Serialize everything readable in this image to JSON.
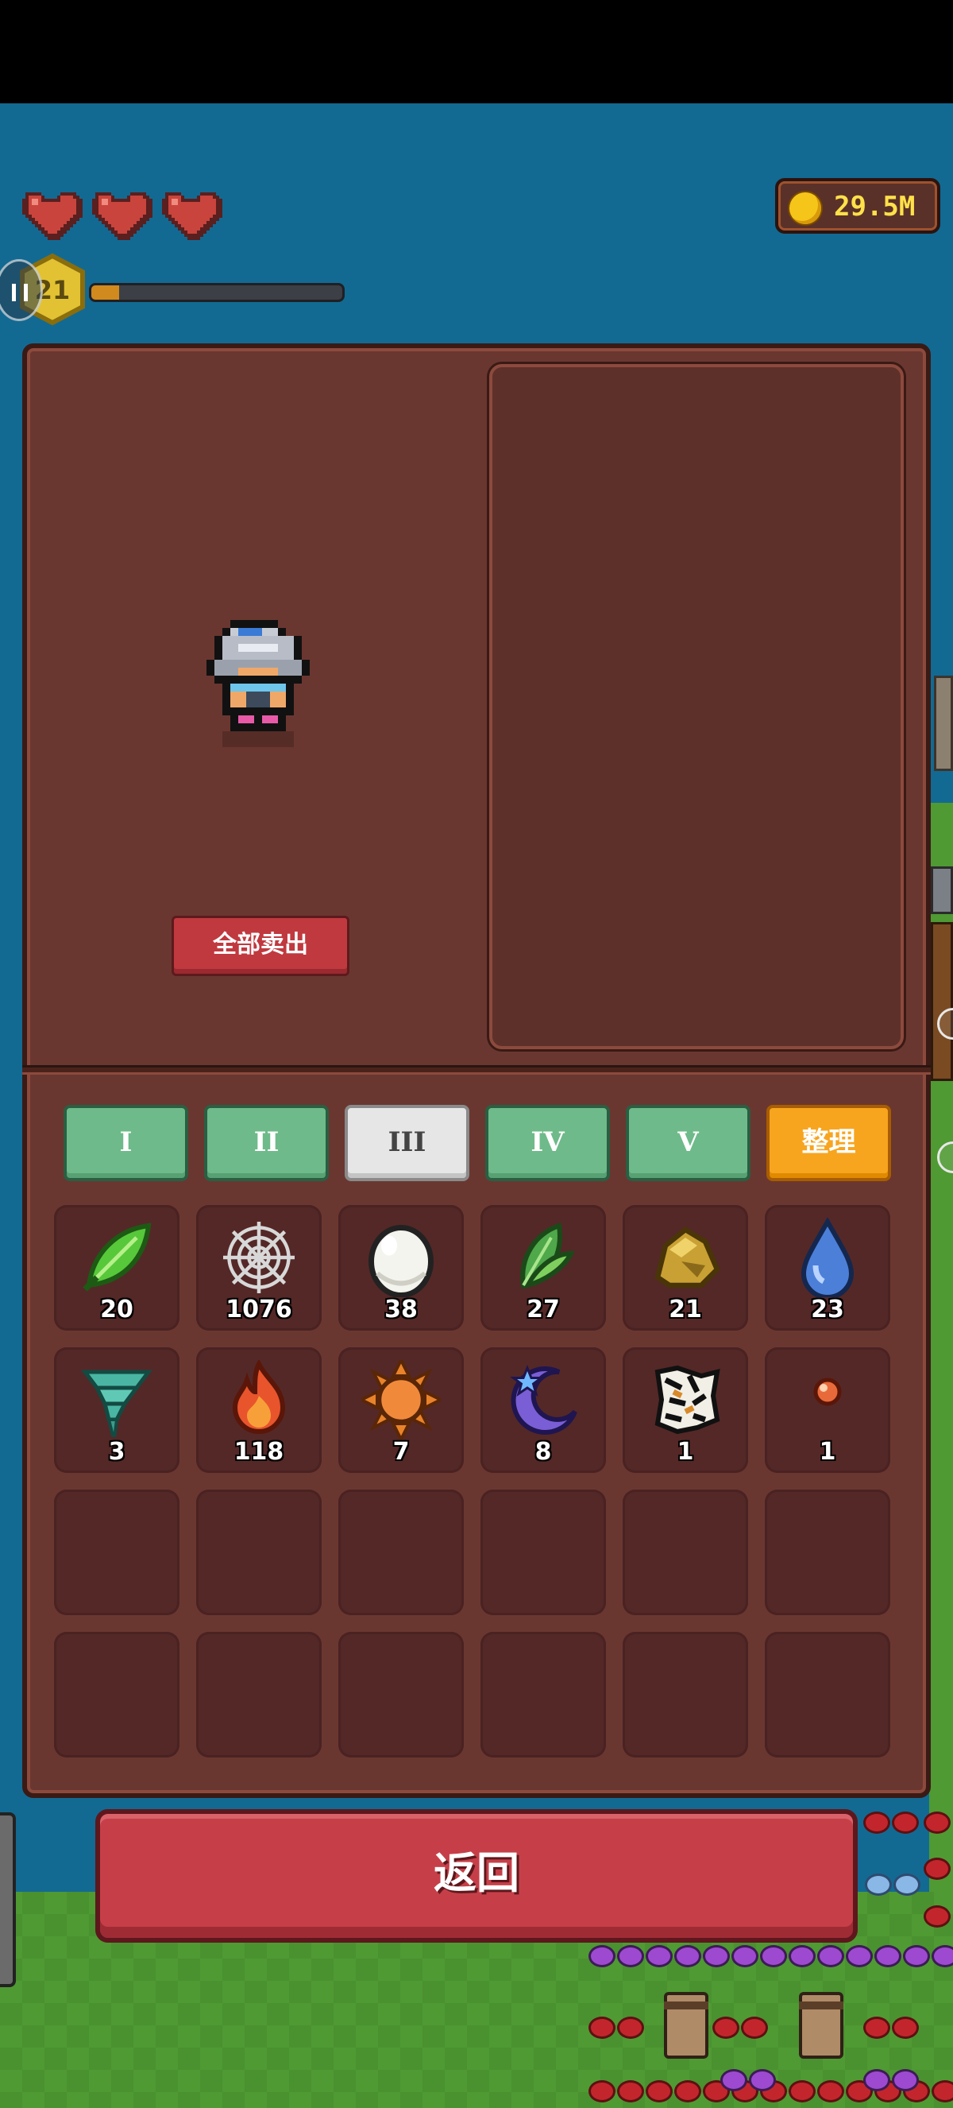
{
  "hud": {
    "hearts": 3,
    "level": "21",
    "xp_progress": 0.11,
    "coins": "29.5M"
  },
  "panel": {
    "sell_all_label": "全部卖出"
  },
  "tabs": [
    {
      "label": "I",
      "active": false
    },
    {
      "label": "II",
      "active": false
    },
    {
      "label": "III",
      "active": true
    },
    {
      "label": "IV",
      "active": false
    },
    {
      "label": "V",
      "active": false
    }
  ],
  "sort_label": "整理",
  "inventory": [
    {
      "icon": "green-leaf-icon",
      "count": "20"
    },
    {
      "icon": "spider-web-icon",
      "count": "1076"
    },
    {
      "icon": "white-egg-icon",
      "count": "38"
    },
    {
      "icon": "herb-leaf-icon",
      "count": "27"
    },
    {
      "icon": "gold-ore-icon",
      "count": "21"
    },
    {
      "icon": "water-drop-icon",
      "count": "23"
    },
    {
      "icon": "tornado-icon",
      "count": "3"
    },
    {
      "icon": "fire-icon",
      "count": "118"
    },
    {
      "icon": "sun-icon",
      "count": "7"
    },
    {
      "icon": "moon-star-icon",
      "count": "8"
    },
    {
      "icon": "tiger-pelt-icon",
      "count": "1"
    },
    {
      "icon": "red-bead-icon",
      "count": "1"
    }
  ],
  "empty_slots": 12,
  "back_label": "返回",
  "colors": {
    "panel": "#6a3730",
    "tab_green": "#6fba8a",
    "tab_sort": "#f7a51f",
    "back_button": "#c63f48",
    "coin_text": "#ffe14a"
  }
}
